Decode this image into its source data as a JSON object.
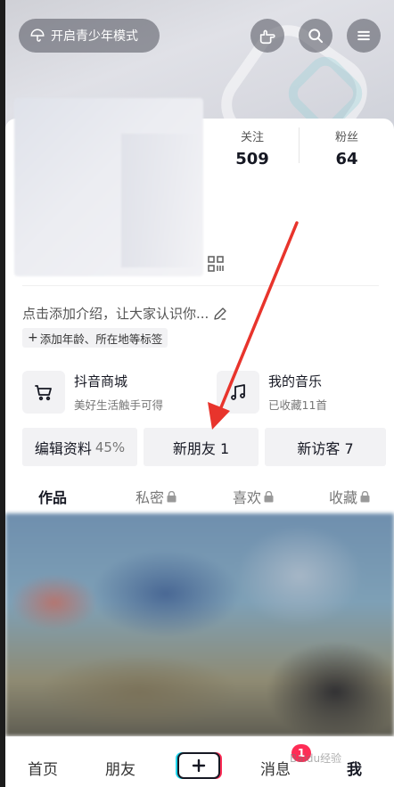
{
  "header": {
    "youth_mode_label": "开启青少年模式"
  },
  "stats": [
    {
      "label": "关注",
      "value": "509"
    },
    {
      "label": "粉丝",
      "value": "64"
    }
  ],
  "profile": {
    "intro_placeholder": "点击添加介绍，让大家认识你...",
    "tag_prompt": "添加年龄、所在地等标签"
  },
  "features": [
    {
      "title": "抖音商城",
      "subtitle": "美好生活触手可得"
    },
    {
      "title": "我的音乐",
      "subtitle": "已收藏11首"
    }
  ],
  "actions": {
    "edit_profile": "编辑资料",
    "edit_profile_pct": "45%",
    "new_friends": "新朋友 1",
    "new_visitors": "新访客 7"
  },
  "tabs": [
    {
      "label": "作品",
      "active": true
    },
    {
      "label": "私密",
      "locked": true
    },
    {
      "label": "喜欢",
      "locked": true
    },
    {
      "label": "收藏",
      "locked": true
    }
  ],
  "bottom_nav": {
    "home": "首页",
    "friends": "朋友",
    "messages": "消息",
    "messages_badge": "1",
    "me": "我"
  },
  "watermark": "Baidu经验",
  "colors": {
    "accent_red": "#fe2c55",
    "accent_cyan": "#20d5ec",
    "annotation_arrow": "#e8342c"
  }
}
